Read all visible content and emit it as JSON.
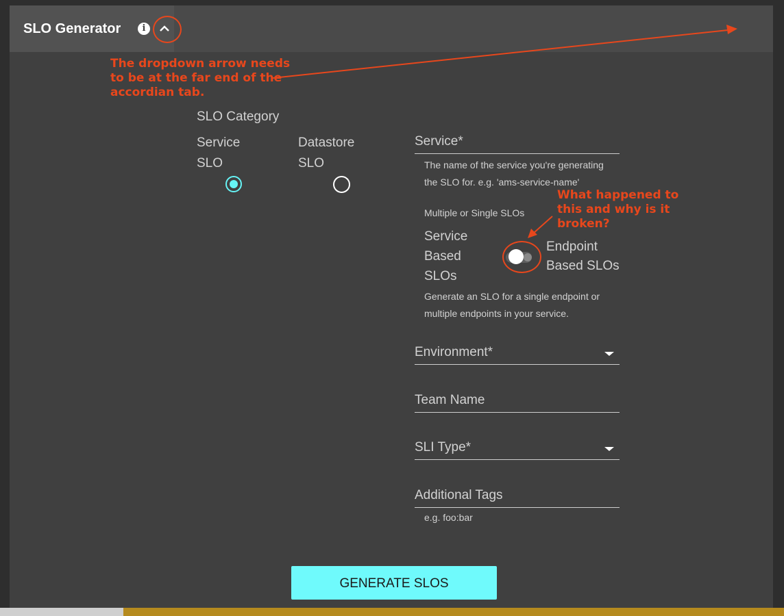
{
  "accordion": {
    "title": "SLO Generator",
    "info_icon": "info-icon",
    "toggle_icon": "chevron-up-icon"
  },
  "annotations": {
    "arrow_note": "The dropdown arrow needs\nto be at the far end of the\naccordian tab.",
    "toggle_note": "What happened to\nthis and why is it\nbroken?",
    "color": "#e8471c"
  },
  "slo_category": {
    "label": "SLO Category",
    "options": [
      {
        "label_line1": "Service",
        "label_line2": "SLO",
        "selected": true
      },
      {
        "label_line1": "Datastore",
        "label_line2": "SLO",
        "selected": false
      }
    ]
  },
  "service_field": {
    "placeholder": "Service*",
    "help_line1": "The name of the service you're generating",
    "help_line2": "the SLO for. e.g. 'ams-service-name'"
  },
  "slo_mode": {
    "label": "Multiple or Single SLOs",
    "left_line1": "Service",
    "left_line2": "Based",
    "left_line3": "SLOs",
    "right_line1": "Endpoint",
    "right_line2": "Based SLOs",
    "help_line1": "Generate an SLO for a single endpoint or",
    "help_line2": "multiple endpoints in your service."
  },
  "environment_field": {
    "placeholder": "Environment*"
  },
  "team_field": {
    "placeholder": "Team Name"
  },
  "sli_field": {
    "placeholder": "SLI Type*"
  },
  "tags_field": {
    "placeholder": "Additional Tags",
    "help": "e.g. foo:bar"
  },
  "generate_button": {
    "label": "GENERATE SLOS"
  },
  "colors": {
    "accent": "#66f4f6",
    "button": "#6ffafc",
    "panel": "#404040"
  }
}
